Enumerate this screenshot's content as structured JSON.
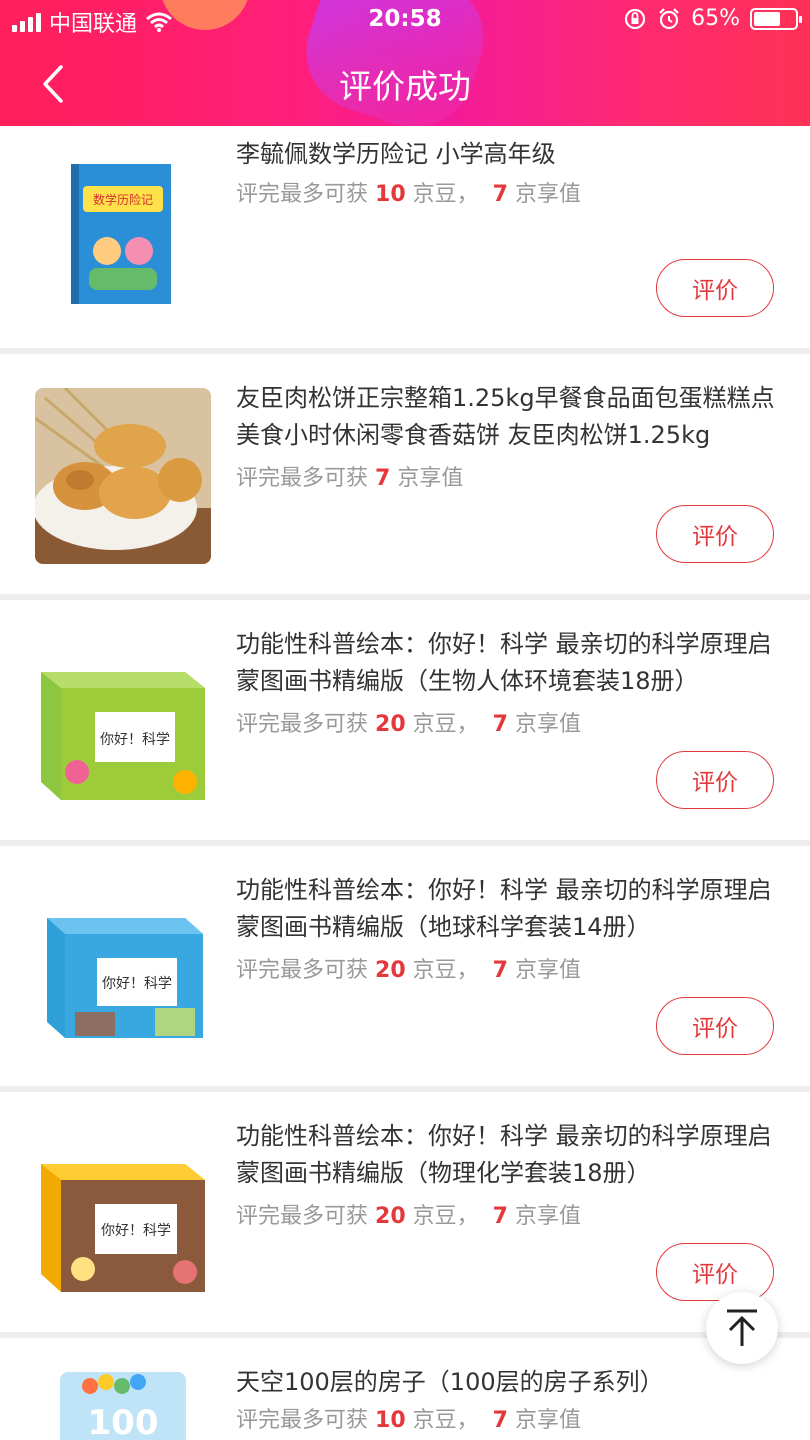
{
  "status": {
    "carrier": "中国联通",
    "time": "20:58",
    "battery": "65%"
  },
  "nav": {
    "title": "评价成功",
    "back_icon": "chevron-left-icon"
  },
  "reward_prefix": "评完最多可获",
  "bean_unit": "京豆，",
  "value_unit": "京享值",
  "eval_label": "评价",
  "items": [
    {
      "title": "李毓佩数学历险记 小学高年级",
      "beans": "10",
      "value": "7",
      "thumb_text": "数学历险记"
    },
    {
      "title": "友臣肉松饼正宗整箱1.25kg早餐食品面包蛋糕糕点美食小时休闲零食香菇饼 友臣肉松饼1.25kg",
      "beans": "",
      "value": "7",
      "thumb_text": ""
    },
    {
      "title": "功能性科普绘本：你好！科学 最亲切的科学原理启蒙图画书精编版（生物人体环境套装18册）",
      "beans": "20",
      "value": "7",
      "thumb_text": "你好！科学"
    },
    {
      "title": "功能性科普绘本：你好！科学 最亲切的科学原理启蒙图画书精编版（地球科学套装14册）",
      "beans": "20",
      "value": "7",
      "thumb_text": "你好！科学"
    },
    {
      "title": "功能性科普绘本：你好！科学 最亲切的科学原理启蒙图画书精编版（物理化学套装18册）",
      "beans": "20",
      "value": "7",
      "thumb_text": "你好！科学"
    },
    {
      "title": "天空100层的房子（100层的房子系列）",
      "beans": "10",
      "value": "7",
      "thumb_text": "100"
    }
  ],
  "colors": {
    "accent": "#e4393c",
    "header_start": "#ff1f5a",
    "header_end": "#ff3155"
  }
}
